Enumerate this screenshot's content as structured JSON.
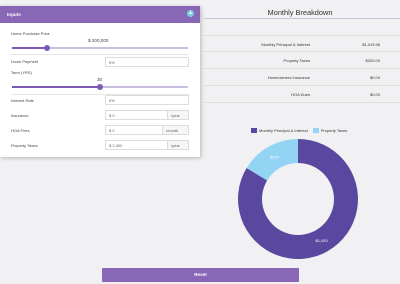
{
  "inputs": {
    "header": "Inputs",
    "collapse_icon": "chevron-up-icon",
    "home_price": {
      "label": "Home Purchase Price",
      "value": "$ 200,000",
      "fraction": 0.2
    },
    "down_payment": {
      "label": "Down Payment",
      "value": "5%"
    },
    "term": {
      "label": "Term (YRS)",
      "value": "30",
      "fraction": 0.5
    },
    "interest_rate": {
      "label": "Interest Rate",
      "value": "5%"
    },
    "insurance": {
      "label": "Insurance",
      "value": "$ 0",
      "suffix": "/year"
    },
    "hoa": {
      "label": "HOA Fees",
      "value": "$ 0",
      "suffix": "/month"
    },
    "property_taxes": {
      "label": "Property Taxes",
      "value": "$ 2,400",
      "suffix": "/year"
    }
  },
  "breakdown": {
    "title": "Monthly Breakdown",
    "rows": [
      {
        "label": "Monthly Principal & Interest",
        "value": "$1,019.96"
      },
      {
        "label": "Property Taxes",
        "value": "$200.00"
      },
      {
        "label": "Homeowners Insurance",
        "value": "$0.00"
      },
      {
        "label": "HOA Dues",
        "value": "$0.00"
      }
    ]
  },
  "chart_data": {
    "type": "pie",
    "variant": "donut",
    "series": [
      {
        "name": "Monthly Principal & Interest",
        "value": 1020,
        "label": "$1,020",
        "color": "#5a479f"
      },
      {
        "name": "Property Taxes",
        "value": 200,
        "label": "$200",
        "color": "#93d3f3"
      }
    ],
    "legend_position": "top"
  },
  "reset_label": "Reset"
}
